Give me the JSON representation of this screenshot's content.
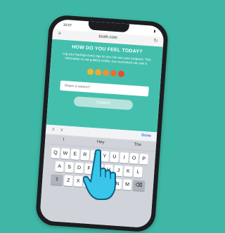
{
  "status": {
    "time": "10:07",
    "battery": "▮"
  },
  "browser": {
    "url": "tooth.com",
    "menu_icon": "≡",
    "reload_icon": "↻"
  },
  "card": {
    "title": "HOW DO YOU FEEL TODAY?",
    "description": "Log your feelings every day so you can see your progress. This information is not publicly visible, but counselors can see it.",
    "mood_options": [
      {
        "name": "mood-1",
        "color": "#f2b82e"
      },
      {
        "name": "mood-2",
        "color": "#f3a632"
      },
      {
        "name": "mood-3",
        "color": "#f19133"
      },
      {
        "name": "mood-4",
        "color": "#ef6e2f"
      },
      {
        "name": "mood-5",
        "color": "#ec4b2c"
      }
    ],
    "reason_placeholder": "Share a reason?",
    "submit_label": "SUBMIT"
  },
  "keyboard_bar": {
    "up_icon": "∧",
    "down_icon": "∨",
    "done_label": "Done"
  },
  "keyboard": {
    "suggestions": [
      "I",
      "Hey",
      "The"
    ],
    "row1": [
      "Q",
      "W",
      "E",
      "R",
      "T",
      "Y",
      "U",
      "I",
      "O",
      "P"
    ],
    "row2": [
      "A",
      "S",
      "D",
      "F",
      "G",
      "H",
      "J",
      "K",
      "L"
    ],
    "row3": [
      "Z",
      "X",
      "C",
      "V",
      "B",
      "N",
      "M"
    ],
    "shift_icon": "⇧",
    "backspace_icon": "⌫"
  }
}
